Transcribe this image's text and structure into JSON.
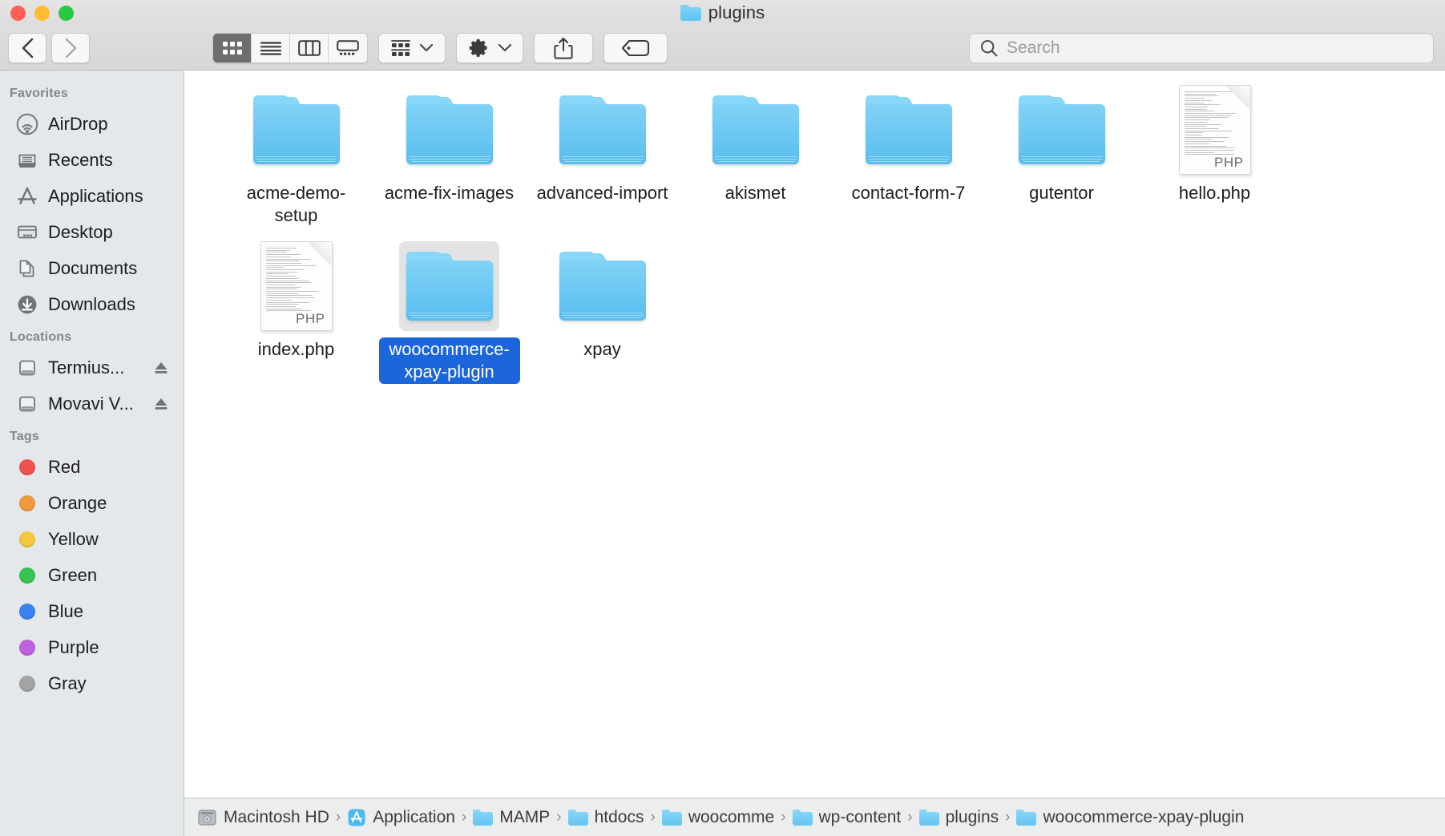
{
  "window": {
    "title": "plugins",
    "title_icon": "folder-icon",
    "traffic_lights": [
      {
        "name": "close",
        "color": "#ff5f57"
      },
      {
        "name": "minimize",
        "color": "#febc2e"
      },
      {
        "name": "zoom",
        "color": "#28c840"
      }
    ]
  },
  "toolbar": {
    "back_icon": "chevron-left-icon",
    "forward_icon": "chevron-right-icon",
    "view_modes": [
      {
        "name": "icon-view",
        "icon": "grid-icon",
        "active": true
      },
      {
        "name": "list-view",
        "icon": "list-icon",
        "active": false
      },
      {
        "name": "column-view",
        "icon": "columns-icon",
        "active": false
      },
      {
        "name": "gallery-view",
        "icon": "gallery-icon",
        "active": false
      }
    ],
    "group_by": {
      "icon": "group-icon",
      "chevron": "chevron-down-icon"
    },
    "action_menu": {
      "icon": "gear-icon",
      "chevron": "chevron-down-icon"
    },
    "share": {
      "icon": "share-icon"
    },
    "tags": {
      "icon": "tag-icon"
    }
  },
  "search": {
    "icon": "search-icon",
    "placeholder": "Search",
    "value": ""
  },
  "sidebar": {
    "sections": [
      {
        "header": "Favorites",
        "items": [
          {
            "label": "AirDrop",
            "icon": "airdrop-icon",
            "eject": false
          },
          {
            "label": "Recents",
            "icon": "recents-icon",
            "eject": false
          },
          {
            "label": "Applications",
            "icon": "applications-icon",
            "eject": false
          },
          {
            "label": "Desktop",
            "icon": "desktop-icon",
            "eject": false
          },
          {
            "label": "Documents",
            "icon": "documents-icon",
            "eject": false
          },
          {
            "label": "Downloads",
            "icon": "downloads-icon",
            "eject": false
          }
        ]
      },
      {
        "header": "Locations",
        "items": [
          {
            "label": "Termius...",
            "icon": "disk-icon",
            "eject": true
          },
          {
            "label": "Movavi V...",
            "icon": "disk-icon",
            "eject": true
          }
        ]
      },
      {
        "header": "Tags",
        "items": [
          {
            "label": "Red",
            "icon": "tag-dot-icon",
            "color": "#ef5350",
            "eject": false
          },
          {
            "label": "Orange",
            "icon": "tag-dot-icon",
            "color": "#ef9a3c",
            "eject": false
          },
          {
            "label": "Yellow",
            "icon": "tag-dot-icon",
            "color": "#f5c73e",
            "eject": false
          },
          {
            "label": "Green",
            "icon": "tag-dot-icon",
            "color": "#38c451",
            "eject": false
          },
          {
            "label": "Blue",
            "icon": "tag-dot-icon",
            "color": "#3b82f0",
            "eject": false
          },
          {
            "label": "Purple",
            "icon": "tag-dot-icon",
            "color": "#bc63dd",
            "eject": false
          },
          {
            "label": "Gray",
            "icon": "tag-dot-icon",
            "color": "#a3a3a3",
            "eject": false
          }
        ]
      }
    ]
  },
  "content": {
    "items": [
      {
        "name": "acme-demo-setup",
        "kind": "folder",
        "selected": false
      },
      {
        "name": "acme-fix-images",
        "kind": "folder",
        "selected": false
      },
      {
        "name": "advanced-import",
        "kind": "folder",
        "selected": false
      },
      {
        "name": "akismet",
        "kind": "folder",
        "selected": false
      },
      {
        "name": "contact-form-7",
        "kind": "folder",
        "selected": false
      },
      {
        "name": "gutentor",
        "kind": "folder",
        "selected": false
      },
      {
        "name": "hello.php",
        "kind": "php",
        "selected": false
      },
      {
        "name": "index.php",
        "kind": "php",
        "selected": false
      },
      {
        "name": "woocommerce-xpay-plugin",
        "kind": "folder",
        "selected": true
      },
      {
        "name": "xpay",
        "kind": "folder",
        "selected": false
      }
    ],
    "php_badge": "PHP",
    "selection_color": "#1b66dc"
  },
  "pathbar": {
    "separator": "›",
    "crumbs": [
      {
        "label": "Macintosh HD",
        "icon": "hard-drive-icon"
      },
      {
        "label": "Application",
        "icon": "app-store-icon"
      },
      {
        "label": "MAMP",
        "icon": "folder-icon"
      },
      {
        "label": "htdocs",
        "icon": "folder-icon"
      },
      {
        "label": "woocomme",
        "icon": "folder-icon"
      },
      {
        "label": "wp-content",
        "icon": "folder-icon"
      },
      {
        "label": "plugins",
        "icon": "folder-icon"
      },
      {
        "label": "woocommerce-xpay-plugin",
        "icon": "folder-icon"
      }
    ]
  }
}
